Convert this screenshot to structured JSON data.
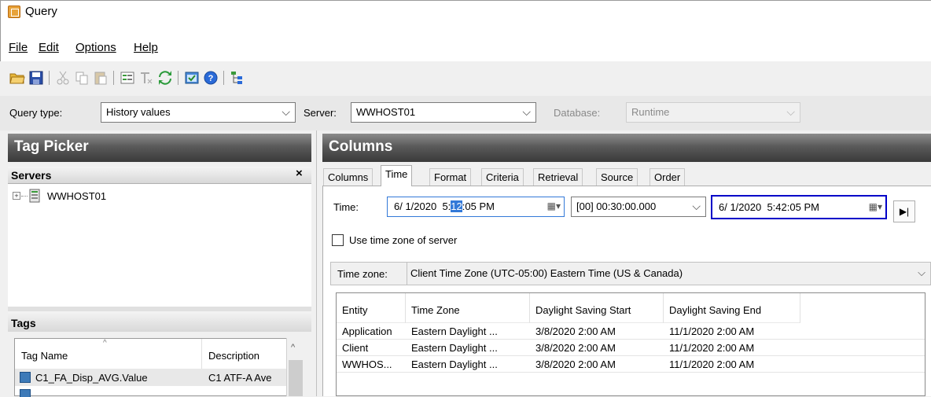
{
  "window": {
    "title": "Query"
  },
  "menu": [
    {
      "label": "File"
    },
    {
      "label": "Edit"
    },
    {
      "label": "Options"
    },
    {
      "label": "Help"
    }
  ],
  "toolbar": {
    "icons": [
      "open-folder-icon",
      "save-icon",
      "cut-icon",
      "copy-icon",
      "paste-icon",
      "properties-icon",
      "clear-format-icon",
      "refresh-icon",
      "preview-icon",
      "help-icon",
      "tree-icon"
    ]
  },
  "query_strip": {
    "query_type_label": "Query type:",
    "query_type_value": "History values",
    "server_label": "Server:",
    "server_value": "WWHOST01",
    "database_label": "Database:",
    "database_value": "Runtime"
  },
  "left": {
    "title": "Tag Picker",
    "servers_label": "Servers",
    "close_glyph": "×",
    "tree": [
      {
        "label": "WWHOST01"
      }
    ],
    "tags_label": "Tags",
    "tags_columns": [
      "Tag Name",
      "Description"
    ],
    "tags_rows": [
      {
        "name": "C1_FA_Disp_AVG.Value",
        "description": "C1 ATF-A Ave"
      }
    ]
  },
  "right": {
    "title": "Columns",
    "tabs": [
      "Columns",
      "Time",
      "Format",
      "Criteria",
      "Retrieval",
      "Source",
      "Order"
    ],
    "active_tab": "Time",
    "time_label": "Time:",
    "start_date": "6/ 1/2020",
    "start_time_pre": "5:",
    "start_time_sel": "12",
    "start_time_post": ":05 PM",
    "duration": "[00] 00:30:00.000",
    "end_date": "6/ 1/2020",
    "end_time": "5:42:05 PM",
    "use_tz_label": "Use time zone of server",
    "use_tz_checked": false,
    "timezone_label": "Time zone:",
    "timezone_value": "Client Time Zone (UTC-05:00) Eastern Time (US & Canada)",
    "zone_table": {
      "columns": [
        "Entity",
        "Time Zone",
        "Daylight Saving Start",
        "Daylight Saving End"
      ],
      "rows": [
        {
          "entity": "Application",
          "zone": "Eastern Daylight ...",
          "start": "3/8/2020 2:00 AM",
          "end": "11/1/2020 2:00 AM"
        },
        {
          "entity": "Client",
          "zone": "Eastern Daylight ...",
          "start": "3/8/2020 2:00 AM",
          "end": "11/1/2020 2:00 AM"
        },
        {
          "entity": "WWHOS...",
          "zone": "Eastern Daylight ...",
          "start": "3/8/2020 2:00 AM",
          "end": "11/1/2020 2:00 AM"
        }
      ]
    }
  },
  "colors": {
    "pane_header_dark": "#3a3a3a",
    "selection_blue": "#3379d8",
    "focus_border": "#0000c8"
  }
}
